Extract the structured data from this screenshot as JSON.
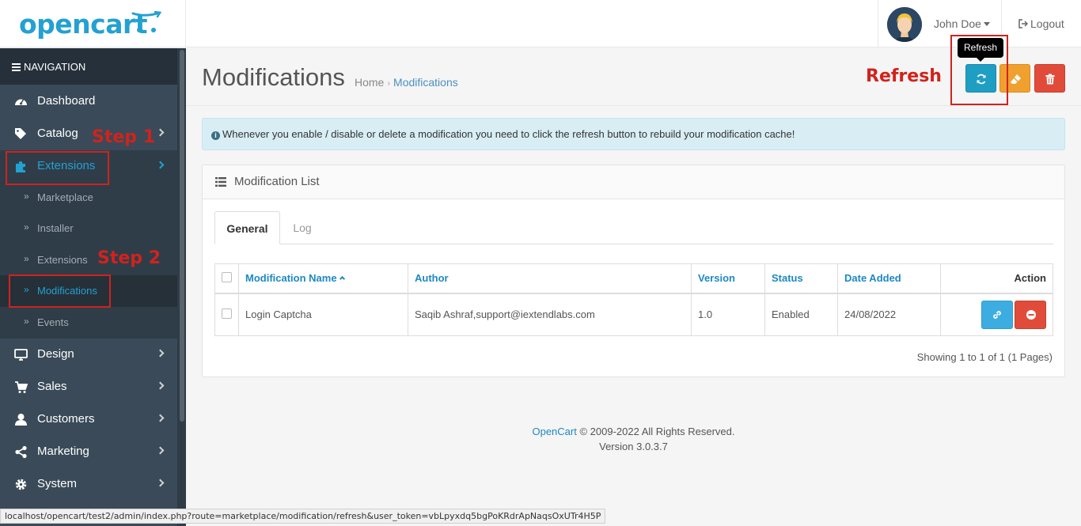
{
  "header": {
    "logo_text": "opencart",
    "user_name": "John Doe",
    "logout_label": "Logout"
  },
  "sidebar": {
    "nav_title": "NAVIGATION",
    "items": [
      {
        "label": "Dashboard",
        "icon": "dashboard-icon"
      },
      {
        "label": "Catalog",
        "icon": "tags-icon"
      },
      {
        "label": "Extensions",
        "icon": "puzzle-icon"
      },
      {
        "label": "Design",
        "icon": "desktop-icon"
      },
      {
        "label": "Sales",
        "icon": "cart-icon"
      },
      {
        "label": "Customers",
        "icon": "user-icon"
      },
      {
        "label": "Marketing",
        "icon": "share-icon"
      },
      {
        "label": "System",
        "icon": "cog-icon"
      }
    ],
    "sub_items": [
      {
        "label": "Marketplace"
      },
      {
        "label": "Installer"
      },
      {
        "label": "Extensions"
      },
      {
        "label": "Modifications"
      },
      {
        "label": "Events"
      }
    ]
  },
  "page": {
    "title": "Modifications",
    "breadcrumb_home": "Home",
    "breadcrumb_sep": "›",
    "breadcrumb_current": "Modifications",
    "tooltip": "Refresh"
  },
  "annotations": {
    "step1": "Step 1",
    "step2": "Step 2",
    "refresh": "Refresh"
  },
  "alert": {
    "text": "Whenever you enable / disable or delete a modification you need to click the refresh button to rebuild your modification cache!"
  },
  "panel": {
    "title": "Modification List",
    "tabs": [
      "General",
      "Log"
    ],
    "columns": [
      "Modification Name",
      "Author",
      "Version",
      "Status",
      "Date Added",
      "Action"
    ],
    "rows": [
      {
        "name": "Login Captcha",
        "author": "Saqib Ashraf,support@iextendlabs.com",
        "version": "1.0",
        "status": "Enabled",
        "date_added": "24/08/2022"
      }
    ],
    "showing": "Showing 1 to 1 of 1 (1 Pages)"
  },
  "footer": {
    "link": "OpenCart",
    "copyright": "© 2009-2022 All Rights Reserved.",
    "version": "Version 3.0.3.7"
  },
  "status_url": "localhost/opencart/test2/admin/index.php?route=marketplace/modification/refresh&user_token=vbLpyxdq5bgPoKRdrApNaqsOxUTr4H5P",
  "colors": {
    "brand": "#23a1d1",
    "sidebar": "#3a4a58",
    "refresh_button": "#1f9ec4",
    "clear_button": "#f0a02f",
    "delete_button": "#e14c3a",
    "annotation": "#d0231d"
  }
}
